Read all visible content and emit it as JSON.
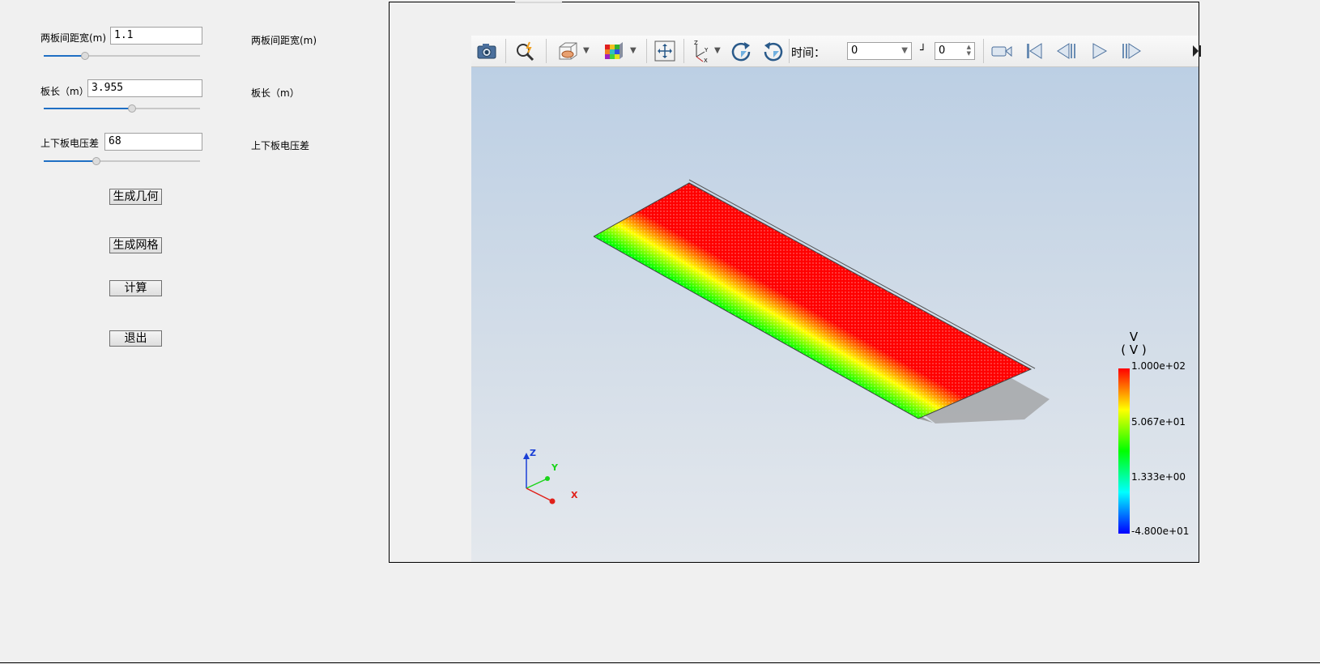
{
  "params": [
    {
      "label": "两板间距宽(m)",
      "value": "1.1",
      "right_label": "两板间距宽(m)",
      "slider_fraction": 0.32
    },
    {
      "label": "板长（m）",
      "value": "3.955",
      "right_label": "板长（m）",
      "slider_fraction": 0.58
    },
    {
      "label": "上下板电压差",
      "value": "68",
      "right_label": "上下板电压差",
      "slider_fraction": 0.34
    }
  ],
  "buttons": {
    "generate_geometry": "生成几何",
    "generate_mesh": "生成网格",
    "compute": "计算",
    "exit": "退出"
  },
  "toolbar": {
    "time_label": "时间：",
    "time_value": "0",
    "step_value": "0",
    "icons": [
      "camera-icon",
      "zoom-icon",
      "surface-display-icon",
      "color-map-icon",
      "fit-view-icon",
      "axes-orientation-icon",
      "rotate-cw-icon",
      "rotate-ccw-icon",
      "record-icon",
      "first-frame-icon",
      "previous-frame-icon",
      "play-icon",
      "next-frame-icon"
    ]
  },
  "legend": {
    "title_line1": "V",
    "title_line2": "( V )",
    "ticks": [
      "1.000e+02",
      "5.067e+01",
      "1.333e+00",
      "-4.800e+01"
    ],
    "colors": [
      "#ff0000",
      "#ffff00",
      "#00ff00",
      "#00ffff",
      "#0000ff"
    ]
  },
  "axes": {
    "z": "Z",
    "y": "Y",
    "x": "X",
    "z_color": "#1a3fd6",
    "y_color": "#1bd41b",
    "x_color": "#e0201a"
  }
}
